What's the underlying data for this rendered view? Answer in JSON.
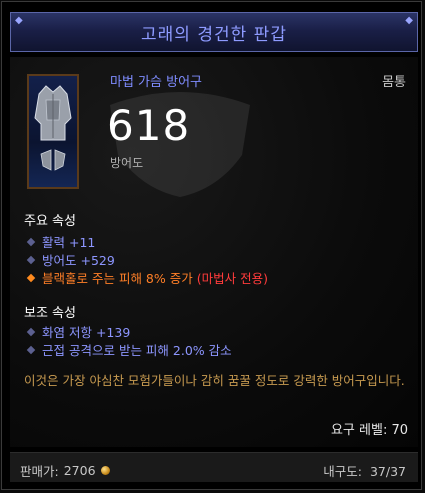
{
  "item": {
    "name": "고래의 경건한 판갑",
    "type": "마법 가슴 방어구",
    "slot": "몸통",
    "armor_value": "618",
    "armor_label": "방어도"
  },
  "primary": {
    "title": "주요 속성",
    "stats": [
      {
        "text": "활력 +11"
      },
      {
        "text": "방어도 +529"
      },
      {
        "text": "블랙홀로 주는 피해 8% 증가",
        "note": "(마법사 전용)"
      }
    ]
  },
  "secondary": {
    "title": "보조 속성",
    "stats": [
      {
        "text": "화염 저항 +139"
      },
      {
        "text": "근접 공격으로 받는 피해 2.0% 감소"
      }
    ]
  },
  "flavor": "이것은 가장 야심찬 모험가들이나 감히 꿈꿀 정도로 강력한 방어구입니다.",
  "requirement": "요구 레벨: 70",
  "footer": {
    "sell_label": "판매가:",
    "sell_value": "2706",
    "durability_label": "내구도:",
    "durability_value": "37/37"
  },
  "colors": {
    "magic_blue": "#8e9bff",
    "legendary_orange": "#ff7f27",
    "class_red": "#ff3b3b",
    "flavor_gold": "#c79a50"
  },
  "icons": {
    "item": "chest-armor-icon",
    "gold": "gold-coin-icon"
  }
}
